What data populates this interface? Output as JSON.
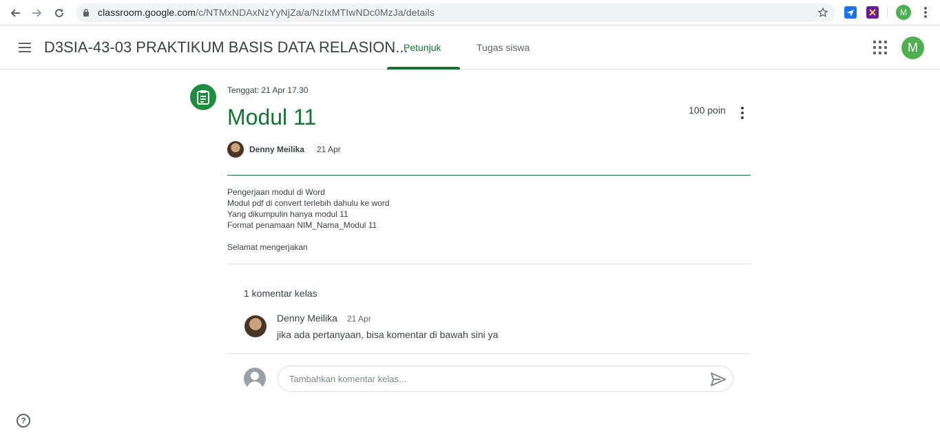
{
  "browser": {
    "url_host": "classroom.google.com",
    "url_path": "/c/NTMxNDAxNzYyNjZa/a/NzIxMTIwNDc0MzJa/details",
    "profile_initial": "M"
  },
  "header": {
    "course_title": "D3SIA-43-03 PRAKTIKUM BASIS DATA RELASION...",
    "tabs": [
      {
        "label": "Petunjuk",
        "active": true
      },
      {
        "label": "Tugas siswa",
        "active": false
      }
    ],
    "avatar_initial": "M"
  },
  "assignment": {
    "due": "Tenggat: 21 Apr 17.30",
    "title": "Modul 11",
    "points": "100 poin",
    "author": "Denny Meilika",
    "date": "21 Apr",
    "description": [
      "Pengerjaan modul di Word",
      "Modul pdf di convert terlebih dahulu ke word",
      "Yang dikumpulin hanya modul 11",
      "Format penamaan NIM_Nama_Modul 11",
      "",
      "Selamat mengerjakan"
    ]
  },
  "comments": {
    "heading": "1 komentar kelas",
    "items": [
      {
        "author": "Denny Meilika",
        "date": "21 Apr",
        "text": "jika ada pertanyaan, bisa komentar di bawah sini ya"
      }
    ],
    "input_placeholder": "Tambahkan komentar kelas..."
  },
  "colors": {
    "accent_green": "#137333",
    "icon_green": "#1e8e3e"
  }
}
